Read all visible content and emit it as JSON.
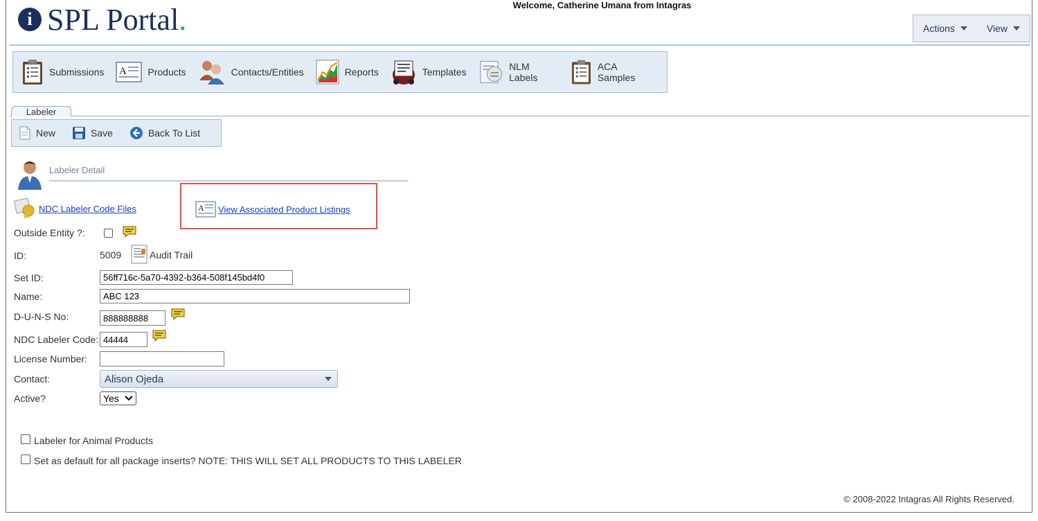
{
  "header": {
    "logo_text": "SPL Portal",
    "logo_dot": ".",
    "logo_mark": "i",
    "welcome": "Welcome, Catherine Umana from Intagras",
    "menu": [
      {
        "label": "Actions"
      },
      {
        "label": "View"
      }
    ]
  },
  "main_toolbar": [
    {
      "label": "Submissions",
      "icon": "clipboard-icon"
    },
    {
      "label": "Products",
      "icon": "document-a-icon"
    },
    {
      "label": "Contacts/Entities",
      "icon": "people-icon"
    },
    {
      "label": "Reports",
      "icon": "chart-icon"
    },
    {
      "label": "Templates",
      "icon": "rolodex-icon"
    },
    {
      "label": "NLM Labels",
      "icon": "label-icon"
    },
    {
      "label": "ACA Samples",
      "icon": "clipboard-icon"
    }
  ],
  "tab": {
    "label": "Labeler"
  },
  "sub_toolbar": {
    "new_label": "New",
    "save_label": "Save",
    "back_label": "Back To List"
  },
  "detail": {
    "title": "Labeler Detail",
    "ndc_files_link": "NDC Labeler Code Files",
    "view_listings_link": "View Associated Product Listings"
  },
  "form": {
    "outside_entity_label": "Outside Entity ?:",
    "id_label": "ID:",
    "id_value": "5009",
    "audit_trail": "Audit Trail",
    "set_id_label": "Set ID:",
    "set_id_value": "56ff716c-5a70-4392-b364-508f145bd4f0",
    "name_label": "Name:",
    "name_value": "ABC 123",
    "duns_label": "D-U-N-S No:",
    "duns_value": "888888888",
    "ndc_label": "NDC Labeler Code:",
    "ndc_value": "44444",
    "license_label": "License Number:",
    "license_value": "",
    "contact_label": "Contact:",
    "contact_value": "Alison Ojeda",
    "active_label": "Active?",
    "active_value": "Yes",
    "animal_label": "Labeler for Animal Products",
    "default_label": "Set as default for all package inserts? NOTE: THIS WILL SET ALL PRODUCTS TO THIS LABELER"
  },
  "footer": {
    "copyright": "© 2008-2022 Intagras All Rights Reserved."
  },
  "colors": {
    "brand": "#1a2f5a",
    "link": "#1a3ec4",
    "highlight": "#d9534f",
    "toolbar_bg": "#e3ecf5"
  }
}
